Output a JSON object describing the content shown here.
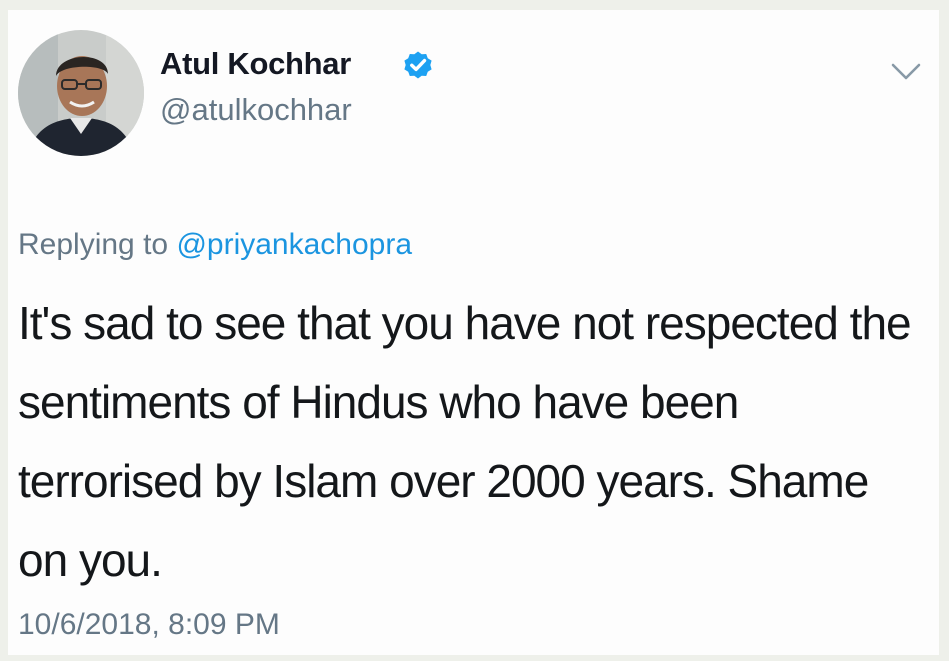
{
  "tweet": {
    "author": {
      "display_name": "Atul Kochhar",
      "handle": "@atulkochhar",
      "verified": true
    },
    "reply_prefix": "Replying to",
    "reply_to": "@priyankachopra",
    "text": "It's sad to see that you have not respected the sentiments of Hindus who have been terrorised by Islam over 2000 years. Shame on you.",
    "timestamp": "10/6/2018, 8:09 PM"
  },
  "icons": {
    "verified": "verified-badge-icon",
    "menu": "chevron-down-icon"
  },
  "colors": {
    "background": "#eef0ea",
    "card": "#fdfdfd",
    "text": "#14171a",
    "secondary": "#657786",
    "link": "#1b95e0",
    "verified": "#1da1f2"
  }
}
